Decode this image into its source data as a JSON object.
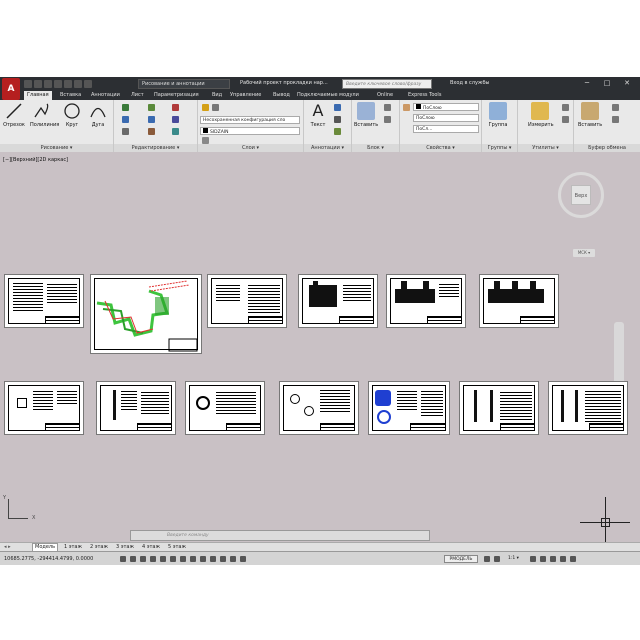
{
  "titlebar": {
    "app_logo": "A",
    "workspace": "Рисование и аннотации",
    "document_title": "Рабочий проект прокладки нар...",
    "search_placeholder": "Введите ключевое слово/фразу",
    "signin": "Вход в службы",
    "minimize": "─",
    "maximize": "□",
    "close": "✕"
  },
  "ribbon_tabs": [
    "Главная",
    "Вставка",
    "Аннотации",
    "Лист",
    "Параметризация",
    "Вид",
    "Управление",
    "Вывод",
    "Подключаемые модули",
    "Online",
    "Express Tools"
  ],
  "panels": {
    "draw": {
      "title": "Рисование ▾",
      "tools": [
        "Отрезок",
        "Полилиния",
        "Круг",
        "Дуга"
      ]
    },
    "modify": {
      "title": "Редактирование ▾"
    },
    "layers": {
      "title": "Слои ▾",
      "layer_state": "Несохраненная конфигурация сло",
      "current_layer": "SIDZAIN"
    },
    "annotation": {
      "title": "Аннотации ▾",
      "text_label": "Текст",
      "text_icon": "A"
    },
    "block": {
      "title": "Блок ▾",
      "insert_label": "Вставить"
    },
    "properties": {
      "title": "Свойства ▾",
      "color": "ПоСлою",
      "linetype": "ПоСлою",
      "lineweight": "ПоСл..."
    },
    "groups": {
      "title": "Группы ▾",
      "label": "Группа"
    },
    "utilities": {
      "title": "Утилиты ▾",
      "label": "Измерить"
    },
    "clipboard": {
      "title": "Буфер обмена",
      "label": "Вставить"
    }
  },
  "viewport": {
    "label": "[−][Верхний][2D каркас]",
    "viewcube_face": "Верх",
    "wcs": "МСК ▾"
  },
  "ucs": {
    "y": "Y",
    "x": "X"
  },
  "command": {
    "placeholder": "Введите команду",
    "close": "✕",
    "options": "✎"
  },
  "layout_tabs": [
    "Модель",
    "1 этаж",
    "2 этаж",
    "3 этаж",
    "4 этаж",
    "5 этаж"
  ],
  "status": {
    "coordinates": "10685.2775, -294414.4799, 0.0000",
    "model": "РМОДЕЛЬ",
    "scale": "1:1 ▾"
  },
  "colors": {
    "accent": "#b51f1f",
    "canvas": "#c9c1c5",
    "green_drawing": "#3ec43e",
    "blue_drawing": "#1f3fd1"
  }
}
